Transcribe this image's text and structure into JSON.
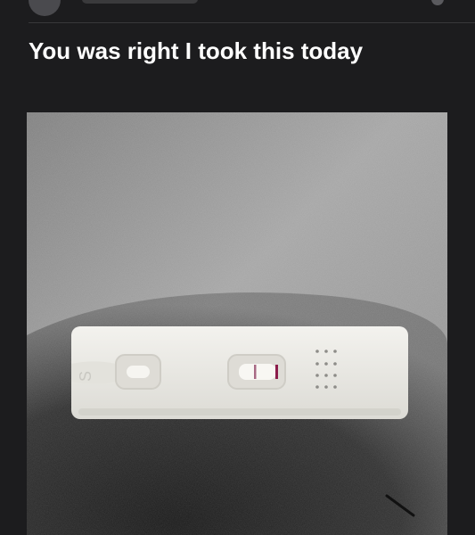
{
  "post": {
    "title": "You was right I took this today",
    "image": {
      "subject": "pregnancy-test",
      "colors": {
        "surface_light": "#9a9a9a",
        "surface_dark": "#3a3a3a",
        "test_body": "#ecebe6",
        "test_line": "#8b1c4a"
      }
    }
  }
}
